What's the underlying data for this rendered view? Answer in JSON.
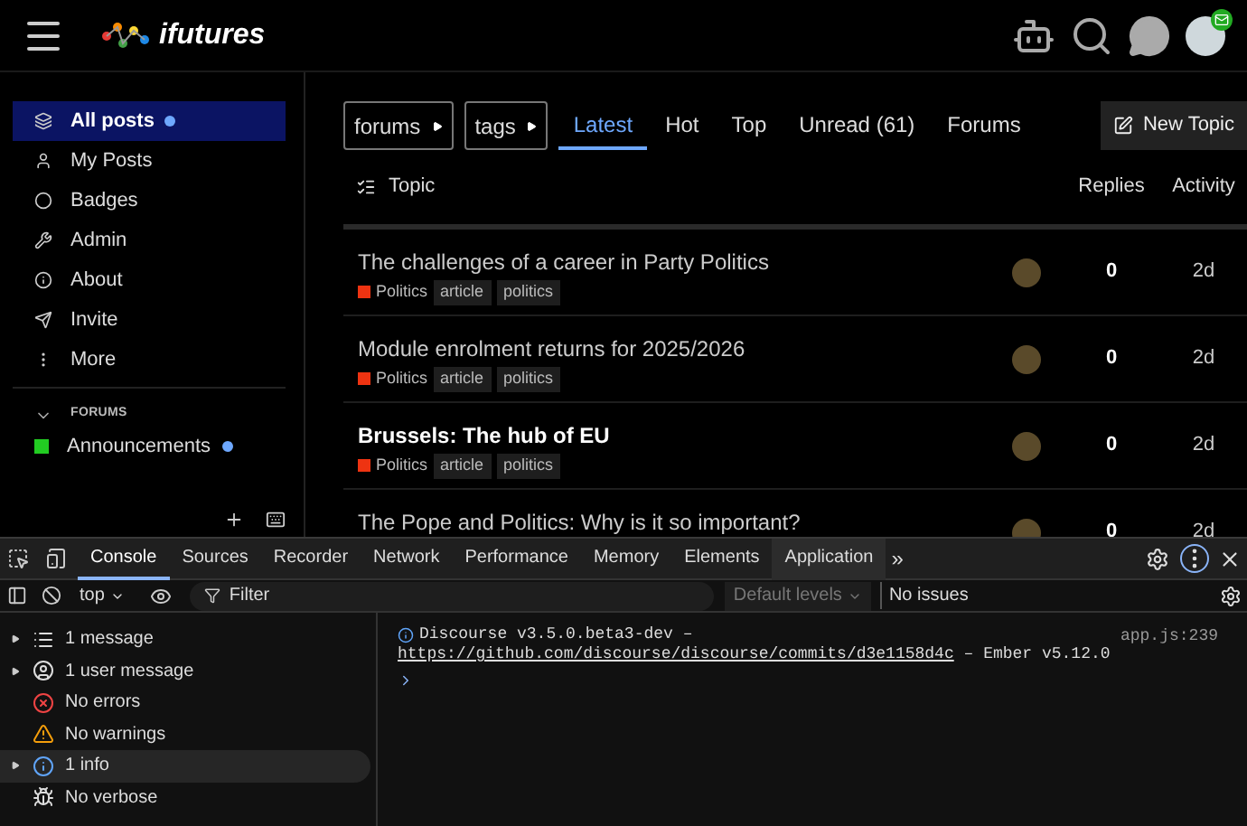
{
  "header": {
    "logo_text": "ifutures",
    "avatar_badge": true
  },
  "sidebar": {
    "items": [
      {
        "label": "All posts",
        "selected": true,
        "unread": true
      },
      {
        "label": "My Posts",
        "selected": false,
        "unread": false
      },
      {
        "label": "Badges",
        "selected": false,
        "unread": false
      },
      {
        "label": "Admin",
        "selected": false,
        "unread": false
      },
      {
        "label": "About",
        "selected": false,
        "unread": false
      },
      {
        "label": "Invite",
        "selected": false,
        "unread": false
      },
      {
        "label": "More",
        "selected": false,
        "unread": false
      }
    ],
    "section": "FORUMS",
    "categories": [
      {
        "label": "Announcements",
        "color": "#22cc22",
        "unread": true
      }
    ]
  },
  "nav": {
    "breadcrumbs": [
      "forums",
      "tags"
    ],
    "tabs": [
      {
        "label": "Latest",
        "selected": true
      },
      {
        "label": "Hot",
        "selected": false
      },
      {
        "label": "Top",
        "selected": false
      },
      {
        "label": "Unread (61)",
        "selected": false
      },
      {
        "label": "Forums",
        "selected": false
      }
    ],
    "new_topic": "New Topic"
  },
  "table": {
    "columns": [
      "Topic",
      "Replies",
      "Activity"
    ],
    "rows": [
      {
        "title": "The challenges of a career in Party Politics",
        "unread": false,
        "category": {
          "name": "Politics",
          "color": "#ee3311"
        },
        "tags": [
          "article",
          "politics"
        ],
        "replies": "0",
        "activity": "2d"
      },
      {
        "title": "Module enrolment returns for 2025/2026",
        "unread": false,
        "category": {
          "name": "Politics",
          "color": "#ee3311"
        },
        "tags": [
          "article",
          "politics"
        ],
        "replies": "0",
        "activity": "2d"
      },
      {
        "title": "Brussels: The hub of EU",
        "unread": true,
        "category": {
          "name": "Politics",
          "color": "#ee3311"
        },
        "tags": [
          "article",
          "politics"
        ],
        "replies": "0",
        "activity": "2d"
      },
      {
        "title": "The Pope and Politics: Why is it so important?",
        "unread": false,
        "replies": "0",
        "activity": "2d"
      }
    ]
  },
  "devtools": {
    "tabs": [
      {
        "label": "Console",
        "selected": true
      },
      {
        "label": "Sources",
        "selected": false
      },
      {
        "label": "Recorder",
        "selected": false
      },
      {
        "label": "Network",
        "selected": false
      },
      {
        "label": "Performance",
        "selected": false
      },
      {
        "label": "Memory",
        "selected": false
      },
      {
        "label": "Elements",
        "selected": false
      },
      {
        "label": "Application",
        "selected": false
      }
    ],
    "more_tabs": "»",
    "context": "top",
    "filter_placeholder": "Filter",
    "levels": "Default levels",
    "issues": "No issues",
    "sidebar": [
      {
        "kind": "messages",
        "label": "1 message",
        "expandable": true,
        "selected": false
      },
      {
        "kind": "user",
        "label": "1 user message",
        "expandable": true,
        "selected": false
      },
      {
        "kind": "error",
        "label": "No errors",
        "expandable": false,
        "selected": false
      },
      {
        "kind": "warning",
        "label": "No warnings",
        "expandable": false,
        "selected": false
      },
      {
        "kind": "info",
        "label": "1 info",
        "expandable": true,
        "selected": true
      },
      {
        "kind": "verbose",
        "label": "No verbose",
        "expandable": false,
        "selected": false
      }
    ],
    "log": {
      "text": "Discourse v3.5.0.beta3-dev –",
      "link": "https://github.com/discourse/discourse/commits/d3e1158d4c",
      "suffix": "– Ember v5.12.0",
      "source": "app.js:239"
    }
  }
}
